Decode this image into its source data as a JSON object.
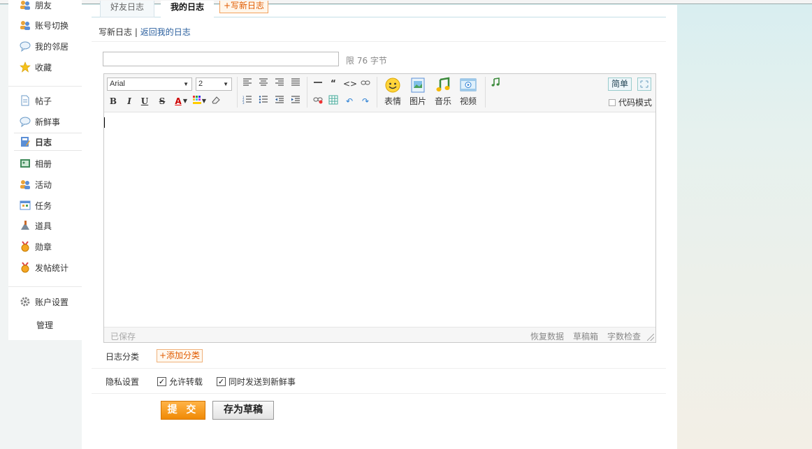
{
  "sidebar": {
    "items": [
      {
        "label": "朋友",
        "icon": "friends-icon"
      },
      {
        "label": "账号切换",
        "icon": "account-switch-icon"
      },
      {
        "label": "我的邻居",
        "icon": "chat-bubble-icon"
      },
      {
        "label": "收藏",
        "icon": "star-icon"
      },
      {
        "label": "帖子",
        "icon": "document-icon"
      },
      {
        "label": "新鲜事",
        "icon": "chat-bubble-icon"
      },
      {
        "label": "日志",
        "icon": "journal-icon"
      },
      {
        "label": "相册",
        "icon": "album-icon"
      },
      {
        "label": "活动",
        "icon": "people-icon"
      },
      {
        "label": "任务",
        "icon": "task-icon"
      },
      {
        "label": "道具",
        "icon": "tool-icon"
      },
      {
        "label": "勋章",
        "icon": "medal-icon"
      },
      {
        "label": "发帖统计",
        "icon": "medal-icon"
      },
      {
        "label": "账户设置",
        "icon": "gear-icon"
      },
      {
        "label": "管理",
        "icon": ""
      }
    ]
  },
  "tabs": {
    "friends": "好友日志",
    "mine": "我的日志",
    "new": "+写新日志"
  },
  "subnav": {
    "write": "写新日志",
    "divider": "|",
    "back": "返回我的日志"
  },
  "title": {
    "value": "",
    "limit": "限 76 字节"
  },
  "toolbar": {
    "font": "Arial",
    "size": "2",
    "emoticon": "表情",
    "image": "图片",
    "music": "音乐",
    "video": "视频",
    "simple": "简单",
    "code_mode": "代码模式"
  },
  "statusbar": {
    "saved": "已保存",
    "restore": "恢复数据",
    "drafts": "草稿箱",
    "wordcount": "字数检查"
  },
  "form": {
    "category_label": "日志分类",
    "add_category": "+添加分类",
    "privacy_label": "隐私设置",
    "allow_repost": "允许转载",
    "send_feed": "同时发送到新鲜事",
    "submit": "提 交",
    "save_draft": "存为草稿"
  },
  "colors": {
    "accent_orange": "#f08a05",
    "link_blue": "#2a5f9e"
  }
}
